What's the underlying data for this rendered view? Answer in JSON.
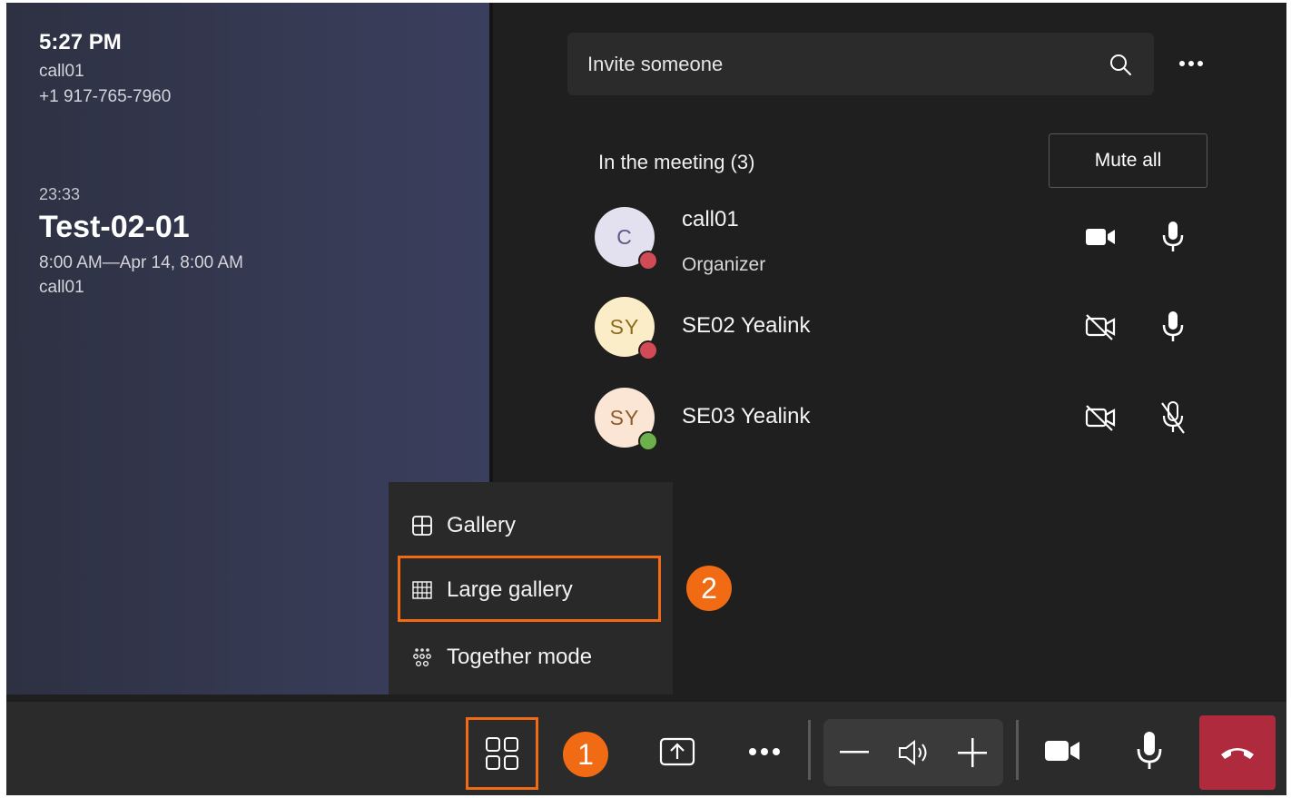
{
  "meeting_info": {
    "clock": "5:27 PM",
    "caller_name": "call01",
    "caller_number": "+1 917-765-7960",
    "duration": "23:33",
    "title": "Test-02-01",
    "time_range": "8:00 AM—Apr 14, 8:00 AM",
    "organizer": "call01"
  },
  "invite": {
    "placeholder": "Invite someone"
  },
  "participants_panel": {
    "header": "In the meeting (3)",
    "mute_all_label": "Mute all",
    "participants": [
      {
        "initials": "C",
        "name": "call01",
        "role": "Organizer",
        "presence": "busy",
        "video": "on",
        "mic": "on"
      },
      {
        "initials": "SY",
        "name": "SE02 Yealink",
        "role": "",
        "presence": "busy",
        "video": "off",
        "mic": "on"
      },
      {
        "initials": "SY",
        "name": "SE03 Yealink",
        "role": "",
        "presence": "available",
        "video": "off",
        "mic": "muted"
      }
    ]
  },
  "layout_menu": {
    "items": [
      {
        "label": "Gallery",
        "icon": "gallery-grid-icon"
      },
      {
        "label": "Large gallery",
        "icon": "large-gallery-grid-icon"
      },
      {
        "label": "Together mode",
        "icon": "together-mode-icon"
      }
    ],
    "highlighted_item": "Large gallery"
  },
  "annotations": {
    "step1": "1",
    "step2": "2"
  },
  "colors": {
    "accent_orange": "#f06b13",
    "hangup_red": "#b02a3e",
    "background": "#1f1f1f",
    "stage_gradient": "#353952"
  }
}
